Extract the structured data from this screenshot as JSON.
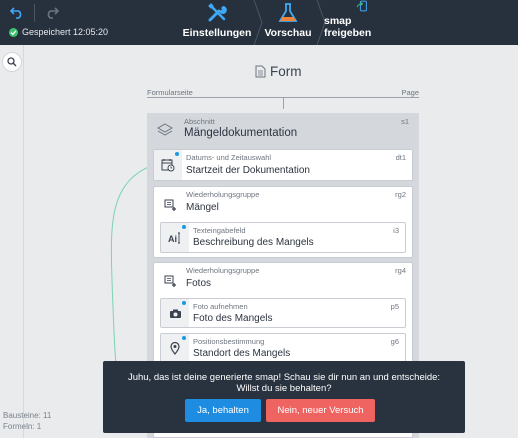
{
  "toolbar": {
    "saved_label": "Gespeichert 12:05:20",
    "nav": {
      "settings": "Einstellungen",
      "preview": "Vorschau",
      "share": "smap freigeben"
    }
  },
  "colors": {
    "topbar": "#27303d",
    "accent_blue": "#1a9be0",
    "saved_green": "#3cc36b",
    "confirm_button": "#1e8ce0",
    "reject_button": "#ef6461"
  },
  "form": {
    "title": "Form",
    "page_left": "Formularseite",
    "page_right": "Page"
  },
  "section": {
    "kind": "Abschnitt",
    "id": "s1",
    "title": "Mängeldokumentation",
    "items": {
      "datetime": {
        "kind": "Datums- und Zeitauswahl",
        "id": "dt1",
        "title": "Startzeit der Dokumentation",
        "icon": "calendar-clock-icon"
      },
      "group_defects": {
        "kind": "Wiederholungsgruppe",
        "id": "rg2",
        "title": "Mängel",
        "icon": "repeat-group-icon",
        "child": {
          "kind": "Texteingabefeld",
          "id": "i3",
          "title": "Beschreibung des Mangels",
          "icon": "text-input-icon"
        }
      },
      "group_photos": {
        "kind": "Wiederholungsgruppe",
        "id": "rg4",
        "title": "Fotos",
        "icon": "repeat-group-icon",
        "children": [
          {
            "kind": "Foto aufnehmen",
            "id": "p5",
            "title": "Foto des Mangels",
            "icon": "camera-icon"
          },
          {
            "kind": "Positionsbestimmung",
            "id": "g6",
            "title": "Standort des Mangels",
            "icon": "location-pin-icon"
          }
        ]
      }
    }
  },
  "stats": {
    "blocks": "Bausteine: 11",
    "formulas": "Formeln: 1"
  },
  "toast": {
    "line1": "Juhu, das ist deine generierte smap! Schau sie dir nun an und entscheide:",
    "line2": "Willst du sie behalten?",
    "yes": "Ja, behalten",
    "no": "Nein, neuer Versuch"
  }
}
